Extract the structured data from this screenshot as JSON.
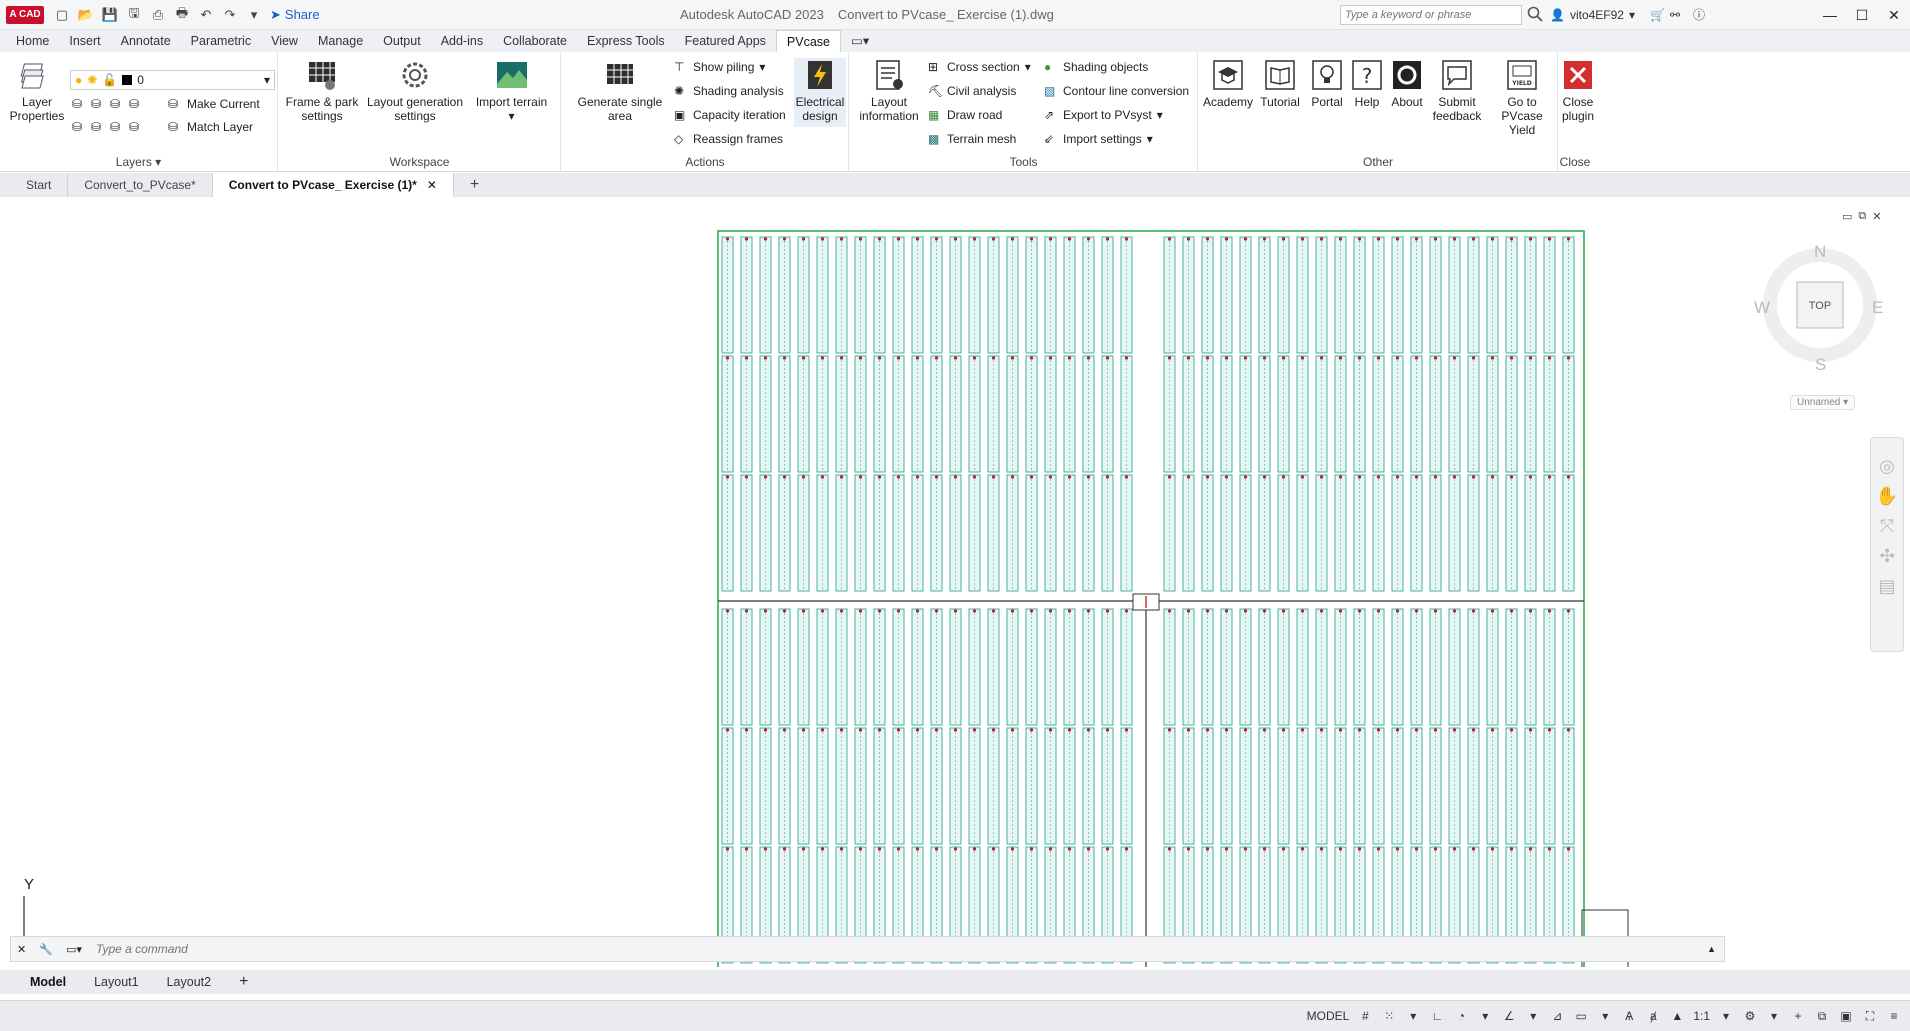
{
  "app": {
    "logo_text": "A CAD",
    "product": "Autodesk AutoCAD 2023",
    "document": "Convert to PVcase_ Exercise (1).dwg",
    "share_label": "Share",
    "search_placeholder": "Type a keyword or phrase",
    "user_name": "vito4EF92"
  },
  "ribbon_tabs": [
    "Home",
    "Insert",
    "Annotate",
    "Parametric",
    "View",
    "Manage",
    "Output",
    "Add-ins",
    "Collaborate",
    "Express Tools",
    "Featured Apps",
    "PVcase"
  ],
  "active_ribbon_tab": "PVcase",
  "panels": {
    "layers": {
      "title": "Layers",
      "layer_properties": "Layer\nProperties",
      "layer_value": "0",
      "make_current": "Make Current",
      "match_layer": "Match Layer"
    },
    "workspace": {
      "title": "Workspace",
      "frame_park": "Frame & park\nsettings",
      "layout_gen": "Layout generation\nsettings",
      "import_terrain": "Import terrain"
    },
    "actions": {
      "title": "Actions",
      "generate_single": "Generate single\narea",
      "show_piling": "Show piling",
      "shading_analysis": "Shading analysis",
      "capacity_iteration": "Capacity iteration",
      "reassign_frames": "Reassign frames",
      "electrical_design": "Electrical\ndesign"
    },
    "tools": {
      "title": "Tools",
      "layout_information": "Layout\ninformation",
      "cross_section": "Cross section",
      "civil_analysis": "Civil analysis",
      "draw_road": "Draw road",
      "terrain_mesh": "Terrain mesh",
      "shading_objects": "Shading objects",
      "contour_line_conversion": "Contour line conversion",
      "export_pvsyst": "Export to PVsyst",
      "import_settings": "Import settings"
    },
    "other": {
      "title": "Other",
      "academy": "Academy",
      "tutorial": "Tutorial",
      "portal": "Portal",
      "help": "Help",
      "about": "About",
      "submit_feedback": "Submit\nfeedback",
      "pvcase_yield": "Go to\nPVcase Yield"
    },
    "close": {
      "title": "Close",
      "close_plugin": "Close\nplugin"
    }
  },
  "doc_tabs": [
    "Start",
    "Convert_to_PVcase*",
    "Convert to PVcase_ Exercise (1)*"
  ],
  "active_doc_tab": "Convert to PVcase_ Exercise (1)*",
  "viewcube": {
    "north": "N",
    "south": "S",
    "east": "E",
    "west": "W",
    "face": "TOP",
    "ucs_name": "Unnamed"
  },
  "ucs_axis": "Y",
  "command_placeholder": "Type a command",
  "layout_tabs": [
    "Model",
    "Layout1",
    "Layout2"
  ],
  "active_layout_tab": "Model",
  "status": {
    "space": "MODEL",
    "scale": "1:1"
  },
  "colors": {
    "accent": "#1e5fbf",
    "logo_red": "#c8102e",
    "boundary_green": "#22aa44",
    "panel_teal": "#1a9e8f",
    "close_red": "#d32f2f"
  }
}
